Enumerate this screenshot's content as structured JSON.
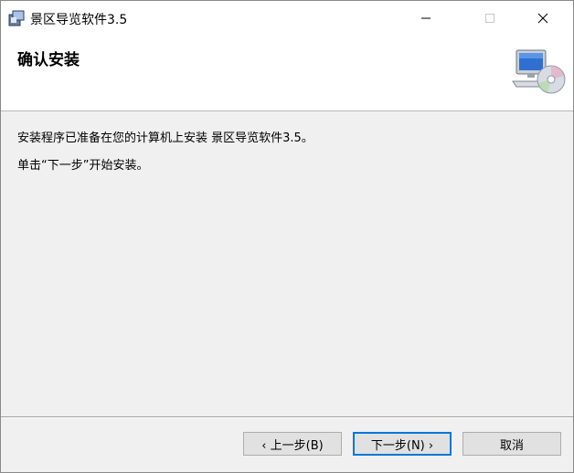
{
  "window": {
    "title": "景区导览软件3.5"
  },
  "banner": {
    "title": "确认安装"
  },
  "body": {
    "message1": "安装程序已准备在您的计算机上安装 景区导览软件3.5。",
    "message2": "单击“下一步”开始安装。"
  },
  "buttons": {
    "back": "‹ 上一步(B)",
    "next": "下一步(N) ›",
    "cancel": "取消"
  },
  "icons": {
    "app": "installer-app-icon",
    "banner": "computer-cd-icon",
    "minimize": "minimize-icon",
    "maximize": "maximize-icon",
    "close": "close-icon"
  }
}
